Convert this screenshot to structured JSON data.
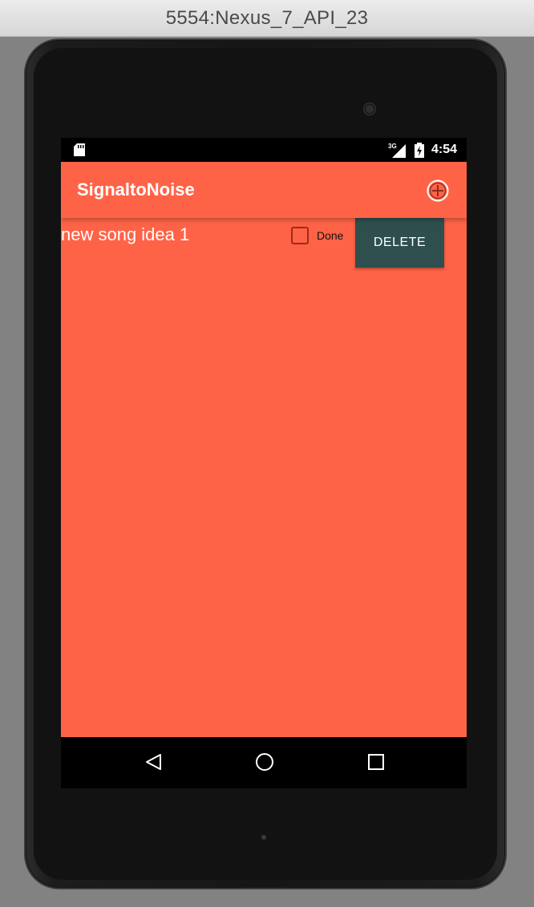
{
  "window": {
    "title": "5554:Nexus_7_API_23"
  },
  "status_bar": {
    "network": "3G",
    "time": "4:54"
  },
  "app_bar": {
    "title": "SignaltoNoise",
    "add_icon": "add-circle-icon"
  },
  "notes": [
    {
      "title": "new song idea 1",
      "done_label": "Done",
      "done_checked": false,
      "delete_label": "DELETE"
    }
  ],
  "nav_bar": {
    "back_icon": "back-icon",
    "home_icon": "home-icon",
    "recents_icon": "recents-icon"
  },
  "colors": {
    "accent": "#ff6347",
    "delete_button": "#2f4f4f",
    "status_bar": "#000000"
  }
}
